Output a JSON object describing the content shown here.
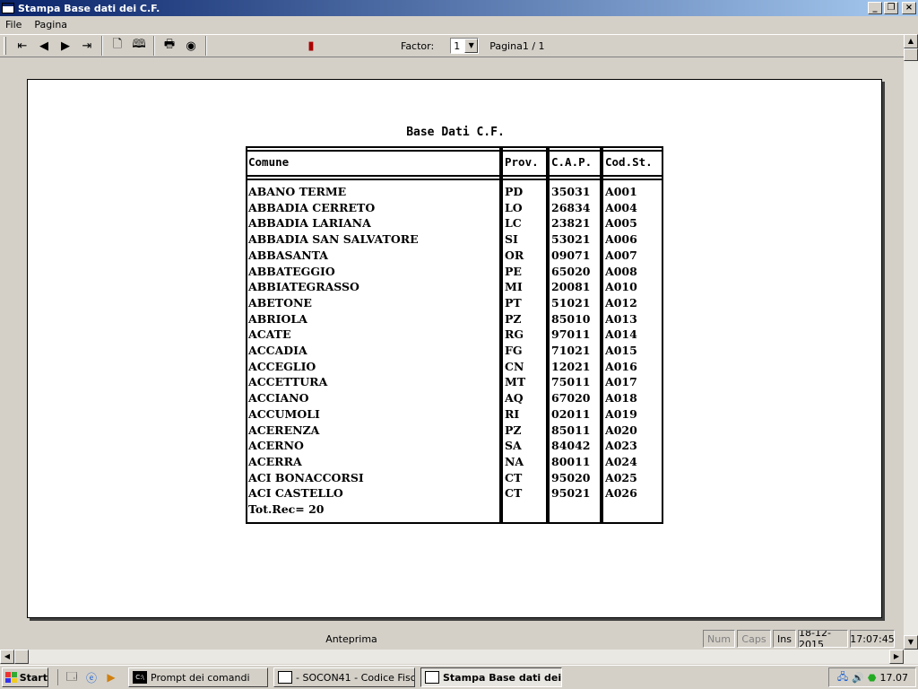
{
  "window": {
    "title": "Stampa Base dati dei C.F."
  },
  "menu": [
    "File",
    "Pagina"
  ],
  "toolbar": {
    "factor_label": "Factor:",
    "factor_value": "1",
    "page_indicator": "Pagina1 / 1",
    "icons": [
      "first-page-icon",
      "prev-page-icon",
      "next-page-icon",
      "last-page-icon",
      "single-page-icon",
      "two-pages-icon",
      "print-icon",
      "export-icon",
      "exit-door-icon"
    ]
  },
  "report": {
    "title": "Base Dati C.F.",
    "headers": [
      "Comune",
      "Prov.",
      "C.A.P.",
      "Cod.St."
    ],
    "rows": [
      [
        "ABANO TERME",
        "PD",
        "35031",
        "A001"
      ],
      [
        "ABBADIA CERRETO",
        "LO",
        "26834",
        "A004"
      ],
      [
        "ABBADIA LARIANA",
        "LC",
        "23821",
        "A005"
      ],
      [
        "ABBADIA SAN SALVATORE",
        "SI",
        "53021",
        "A006"
      ],
      [
        "ABBASANTA",
        "OR",
        "09071",
        "A007"
      ],
      [
        "ABBATEGGIO",
        "PE",
        "65020",
        "A008"
      ],
      [
        "ABBIATEGRASSO",
        "MI",
        "20081",
        "A010"
      ],
      [
        "ABETONE",
        "PT",
        "51021",
        "A012"
      ],
      [
        "ABRIOLA",
        "PZ",
        "85010",
        "A013"
      ],
      [
        "ACATE",
        "RG",
        "97011",
        "A014"
      ],
      [
        "ACCADIA",
        "FG",
        "71021",
        "A015"
      ],
      [
        "ACCEGLIO",
        "CN",
        "12021",
        "A016"
      ],
      [
        "ACCETTURA",
        "MT",
        "75011",
        "A017"
      ],
      [
        "ACCIANO",
        "AQ",
        "67020",
        "A018"
      ],
      [
        "ACCUMOLI",
        "RI",
        "02011",
        "A019"
      ],
      [
        "ACERENZA",
        "PZ",
        "85011",
        "A020"
      ],
      [
        "ACERNO",
        "SA",
        "84042",
        "A023"
      ],
      [
        "ACERRA",
        "NA",
        "80011",
        "A024"
      ],
      [
        "ACI BONACCORSI",
        "CT",
        "95020",
        "A025"
      ],
      [
        "ACI CASTELLO",
        "CT",
        "95021",
        "A026"
      ]
    ],
    "total": "Tot.Rec= 20"
  },
  "statusbar": {
    "main": "Anteprima",
    "num": "Num",
    "caps": "Caps",
    "ins": "Ins",
    "date": "18-12-2015",
    "time": "17:07:45"
  },
  "taskbar": {
    "start": "Start",
    "tasks": [
      "Prompt dei comandi",
      "- SOCON41 - Codice Fisc...",
      "Stampa Base dati dei ..."
    ],
    "clock": "17.07"
  }
}
